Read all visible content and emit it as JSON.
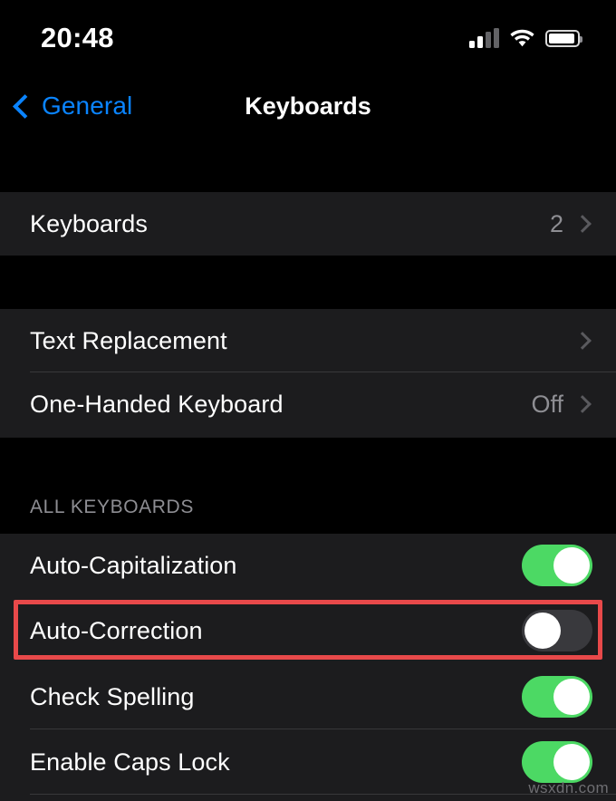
{
  "status_bar": {
    "time": "20:48",
    "signal_icon": "cellular-signal-icon",
    "wifi_icon": "wifi-icon",
    "battery_icon": "battery-icon"
  },
  "nav": {
    "back_icon": "chevron-left-icon",
    "back_label": "General",
    "title": "Keyboards"
  },
  "sections": [
    {
      "header": "",
      "rows": [
        {
          "label": "Keyboards",
          "value": "2",
          "accessory": "chevron-right-icon"
        }
      ]
    },
    {
      "header": "",
      "rows": [
        {
          "label": "Text Replacement",
          "value": "",
          "accessory": "chevron-right-icon"
        },
        {
          "label": "One-Handed Keyboard",
          "value": "Off",
          "accessory": "chevron-right-icon"
        }
      ]
    },
    {
      "header": "ALL KEYBOARDS",
      "rows": [
        {
          "label": "Auto-Capitalization",
          "toggle": "on"
        },
        {
          "label": "Auto-Correction",
          "toggle": "off"
        },
        {
          "label": "Check Spelling",
          "toggle": "on"
        },
        {
          "label": "Enable Caps Lock",
          "toggle": "on"
        }
      ]
    }
  ],
  "highlight": {
    "target_label": "Auto-Correction",
    "color": "#e8494a"
  },
  "watermark": "wsxdn.com",
  "colors": {
    "background": "#000000",
    "row_background": "#1c1c1e",
    "accent_blue": "#0a84ff",
    "toggle_on": "#4cd964",
    "toggle_off": "#39393d",
    "secondary_text": "#8e8e93",
    "highlight_red": "#e8494a"
  }
}
